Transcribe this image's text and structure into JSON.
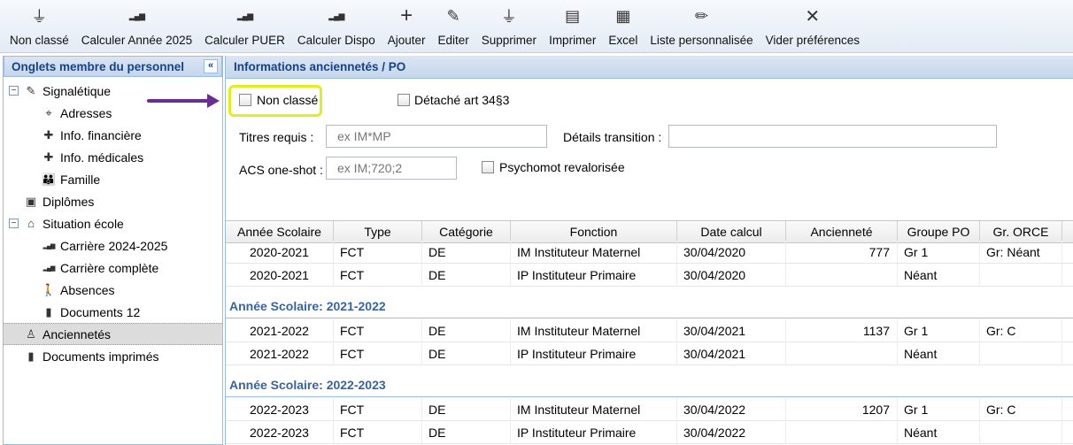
{
  "toolbar": {
    "buttons": [
      {
        "id": "non-classe",
        "label": "Non classé",
        "icon": "funnel-icon",
        "glyph": "⏚"
      },
      {
        "id": "calc-annee",
        "label": "Calculer Année 2025",
        "icon": "bar-chart-icon",
        "glyph": "▂▄▆"
      },
      {
        "id": "calc-puer",
        "label": "Calculer PUER",
        "icon": "bar-chart-icon",
        "glyph": "▂▄▆"
      },
      {
        "id": "calc-dispo",
        "label": "Calculer Dispo",
        "icon": "bar-chart-icon",
        "glyph": "▂▄▆"
      },
      {
        "id": "ajouter",
        "label": "Ajouter",
        "icon": "plus-icon",
        "glyph": "+"
      },
      {
        "id": "editer",
        "label": "Editer",
        "icon": "edit-icon",
        "glyph": "✎"
      },
      {
        "id": "supprimer",
        "label": "Supprimer",
        "icon": "funnel-icon",
        "glyph": "⏚"
      },
      {
        "id": "imprimer",
        "label": "Imprimer",
        "icon": "pdf-icon",
        "glyph": "▤"
      },
      {
        "id": "excel",
        "label": "Excel",
        "icon": "excel-icon",
        "glyph": "▦"
      },
      {
        "id": "liste-perso",
        "label": "Liste personnalisée",
        "icon": "pencil-icon",
        "glyph": "✏"
      },
      {
        "id": "vider-pref",
        "label": "Vider préférences",
        "icon": "close-icon",
        "glyph": "✕"
      }
    ]
  },
  "left_panel": {
    "title": "Onglets membre du personnel",
    "collapse_glyph": "«",
    "items": [
      {
        "label": "Signalétique",
        "icon": "edit-doc-icon",
        "glyph": "✎",
        "level": 0,
        "expander": "−"
      },
      {
        "label": "Adresses",
        "icon": "map-pin-icon",
        "glyph": "⌖",
        "level": 1
      },
      {
        "label": "Info. financière",
        "icon": "first-aid-icon",
        "glyph": "✚",
        "level": 1
      },
      {
        "label": "Info. médicales",
        "icon": "first-aid-icon",
        "glyph": "✚",
        "level": 1
      },
      {
        "label": "Famille",
        "icon": "family-icon",
        "glyph": "👪",
        "level": 1
      },
      {
        "label": "Diplômes",
        "icon": "certificate-icon",
        "glyph": "▣",
        "level": 0
      },
      {
        "label": "Situation école",
        "icon": "school-icon",
        "glyph": "⌂",
        "level": 0,
        "expander": "−"
      },
      {
        "label": "Carrière 2024-2025",
        "icon": "bar-chart-icon",
        "glyph": "▂▄▆",
        "level": 1
      },
      {
        "label": "Carrière complète",
        "icon": "bar-chart-icon",
        "glyph": "▂▄▆",
        "level": 1
      },
      {
        "label": "Absences",
        "icon": "walking-person-icon",
        "glyph": "🚶",
        "level": 1
      },
      {
        "label": "Documents 12",
        "icon": "document-icon",
        "glyph": "▮",
        "level": 1
      },
      {
        "label": "Anciennetés",
        "icon": "person-icon",
        "glyph": "♙",
        "level": 0,
        "selected": true
      },
      {
        "label": "Documents imprimés",
        "icon": "document-icon",
        "glyph": "▮",
        "level": 0
      }
    ]
  },
  "right_panel": {
    "title": "Informations anciennetés / PO",
    "form": {
      "non_classe_label": "Non classé",
      "non_classe_checked": false,
      "detache_label": "Détaché art 34§3",
      "detache_checked": false,
      "titres_label": "Titres requis :",
      "titres_placeholder": "ex IM*MP",
      "details_label": "Détails transition :",
      "details_value": "",
      "acs_label": "ACS one-shot :",
      "acs_placeholder": "ex IM;720;2",
      "psycho_label": "Psychomot revalorisée",
      "psycho_checked": false
    },
    "grid": {
      "columns": [
        "Année Scolaire",
        "Type",
        "Catégorie",
        "Fonction",
        "Date calcul",
        "Ancienneté",
        "Groupe PO",
        "Gr. ORCE"
      ],
      "rows_top": [
        [
          "2020-2021",
          "FCT",
          "DE",
          "IM Instituteur Maternel",
          "30/04/2020",
          "777",
          "Gr 1",
          "Gr: Néant"
        ],
        [
          "2020-2021",
          "FCT",
          "DE",
          "IP Instituteur Primaire",
          "30/04/2020",
          "",
          "Néant",
          ""
        ]
      ],
      "groups": [
        {
          "label": "Année Scolaire: 2021-2022",
          "rows": [
            [
              "2021-2022",
              "FCT",
              "DE",
              "IM Instituteur Maternel",
              "30/04/2021",
              "1137",
              "Gr 1",
              "Gr: C"
            ],
            [
              "2021-2022",
              "FCT",
              "DE",
              "IP Instituteur Primaire",
              "30/04/2021",
              "",
              "Néant",
              ""
            ]
          ]
        },
        {
          "label": "Année Scolaire: 2022-2023",
          "rows": [
            [
              "2022-2023",
              "FCT",
              "DE",
              "IM Instituteur Maternel",
              "30/04/2022",
              "1207",
              "Gr 1",
              "Gr: C"
            ],
            [
              "2022-2023",
              "FCT",
              "DE",
              "IP Instituteur Primaire",
              "30/04/2022",
              "",
              "Néant",
              ""
            ]
          ]
        }
      ]
    }
  },
  "annotations": {
    "arrow_color": "#6b2d91",
    "highlight_color": "#e3ec1c"
  }
}
